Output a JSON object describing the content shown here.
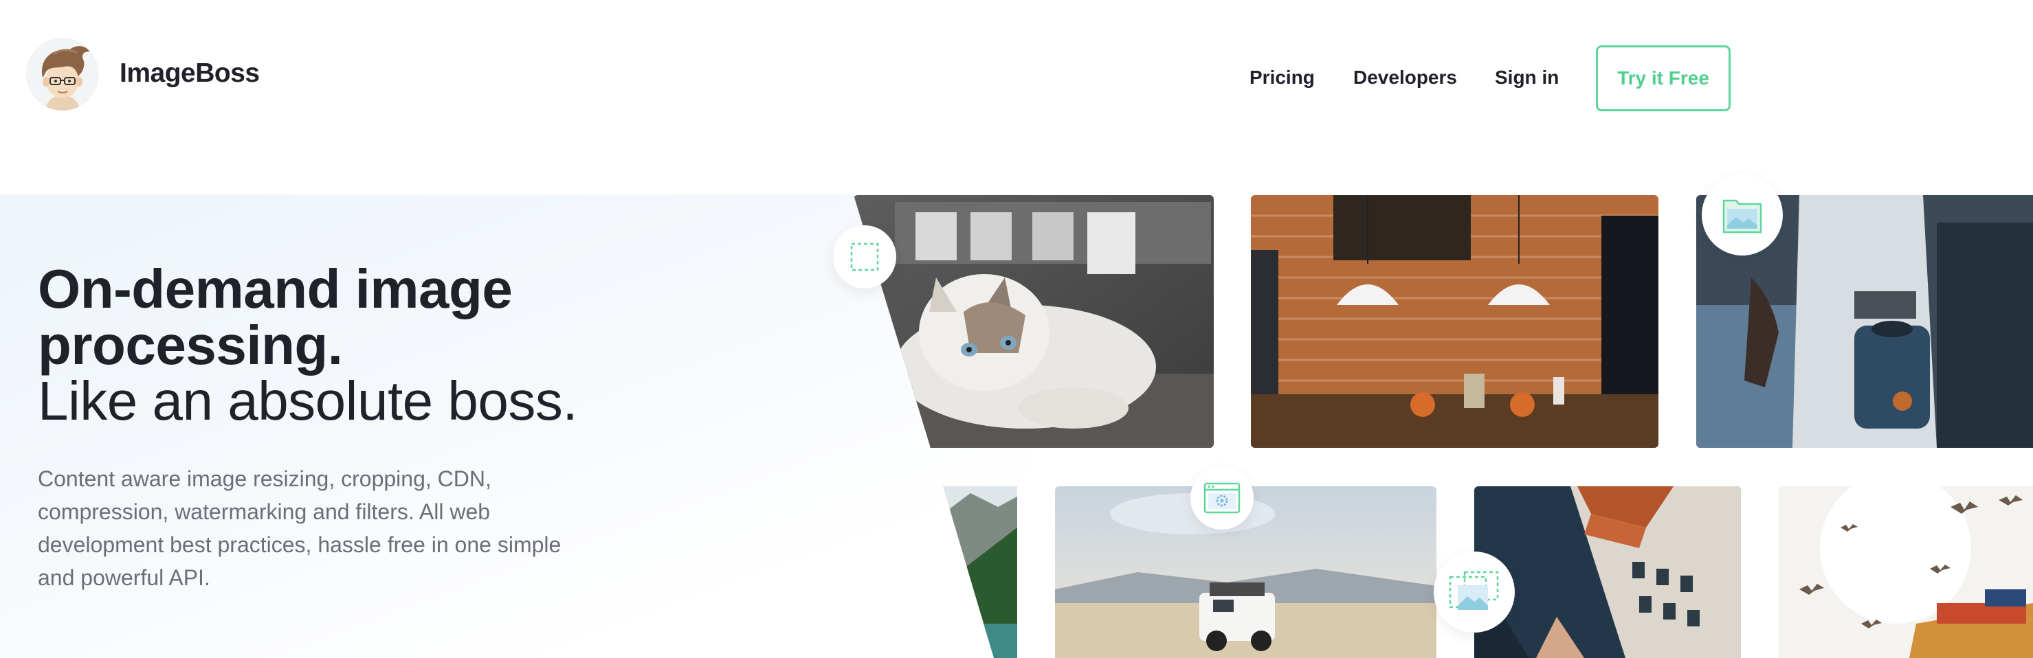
{
  "brand": {
    "name": "ImageBoss",
    "logo_icon": "cartoon-boss-avatar-icon"
  },
  "nav": {
    "pricing": "Pricing",
    "developers": "Developers",
    "sign_in": "Sign in",
    "cta": "Try it Free"
  },
  "hero": {
    "headline": "On-demand image processing.",
    "subhead": "Like an absolute boss.",
    "description": "Content aware image resizing, cropping, CDN, compression, watermarking and filters. All web development best practices, hassle free in one simple and powerful API."
  },
  "gallery": {
    "feature_icons": [
      "crop-icon",
      "image-folder-icon",
      "image-settings-icon",
      "image-resize-icon"
    ],
    "photos": [
      "cat-photo",
      "brick-wall-dining-photo",
      "coffee-man-photo",
      "mountain-lake-photo",
      "land-rover-desert-photo",
      "aerial-buildings-photo",
      "seagulls-city-photo"
    ]
  },
  "colors": {
    "accent": "#4fcf8e",
    "text": "#20212b",
    "muted": "#6b6e78"
  }
}
